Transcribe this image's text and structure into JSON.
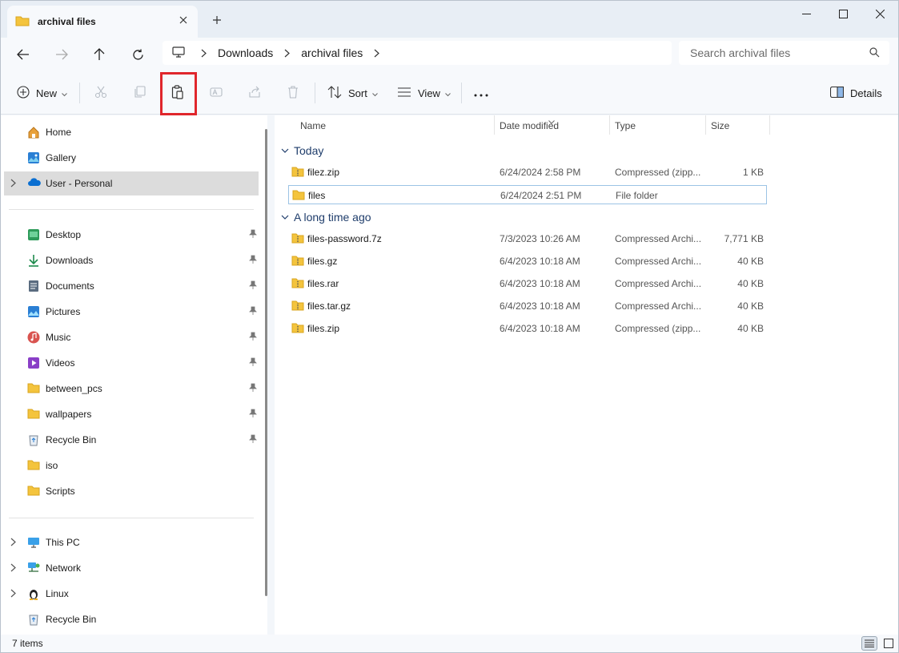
{
  "window": {
    "tab_title": "archival files",
    "colors": {
      "accent": "#0067c0",
      "highlight": "#e0262c",
      "folder": "#f4c43d"
    }
  },
  "nav": {
    "breadcrumbs": [
      "Downloads",
      "archival files"
    ],
    "search_placeholder": "Search archival files"
  },
  "toolbar": {
    "new_label": "New",
    "sort_label": "Sort",
    "view_label": "View",
    "details_label": "Details"
  },
  "sidebar": {
    "top": [
      {
        "label": "Home",
        "icon": "home-icon"
      },
      {
        "label": "Gallery",
        "icon": "gallery-icon"
      },
      {
        "label": "User - Personal",
        "icon": "onedrive-icon"
      }
    ],
    "pinned": [
      {
        "label": "Desktop",
        "icon": "desktop-icon"
      },
      {
        "label": "Downloads",
        "icon": "downloads-icon"
      },
      {
        "label": "Documents",
        "icon": "documents-icon"
      },
      {
        "label": "Pictures",
        "icon": "pictures-icon"
      },
      {
        "label": "Music",
        "icon": "music-icon"
      },
      {
        "label": "Videos",
        "icon": "videos-icon"
      },
      {
        "label": "between_pcs",
        "icon": "folder-icon"
      },
      {
        "label": "wallpapers",
        "icon": "folder-icon"
      },
      {
        "label": "Recycle Bin",
        "icon": "recycle-bin-icon"
      },
      {
        "label": "iso",
        "icon": "folder-icon"
      },
      {
        "label": "Scripts",
        "icon": "folder-icon"
      }
    ],
    "bottom": [
      {
        "label": "This PC",
        "icon": "this-pc-icon"
      },
      {
        "label": "Network",
        "icon": "network-icon"
      },
      {
        "label": "Linux",
        "icon": "linux-icon"
      },
      {
        "label": "Recycle Bin",
        "icon": "recycle-bin-icon"
      }
    ]
  },
  "columns": {
    "name": "Name",
    "date": "Date modified",
    "type": "Type",
    "size": "Size"
  },
  "groups": [
    {
      "label": "Today",
      "files": [
        {
          "name": "filez.zip",
          "date": "6/24/2024 2:58 PM",
          "type": "Compressed (zipp...",
          "size": "1 KB",
          "icon": "zip-icon"
        },
        {
          "name": "files",
          "date": "6/24/2024 2:51 PM",
          "type": "File folder",
          "size": "",
          "icon": "folder-icon"
        }
      ]
    },
    {
      "label": "A long time ago",
      "files": [
        {
          "name": "files-password.7z",
          "date": "7/3/2023 10:26 AM",
          "type": "Compressed Archi...",
          "size": "7,771 KB",
          "icon": "archive-icon"
        },
        {
          "name": "files.gz",
          "date": "6/4/2023 10:18 AM",
          "type": "Compressed Archi...",
          "size": "40 KB",
          "icon": "archive-icon"
        },
        {
          "name": "files.rar",
          "date": "6/4/2023 10:18 AM",
          "type": "Compressed Archi...",
          "size": "40 KB",
          "icon": "archive-icon"
        },
        {
          "name": "files.tar.gz",
          "date": "6/4/2023 10:18 AM",
          "type": "Compressed Archi...",
          "size": "40 KB",
          "icon": "archive-icon"
        },
        {
          "name": "files.zip",
          "date": "6/4/2023 10:18 AM",
          "type": "Compressed (zipp...",
          "size": "40 KB",
          "icon": "zip-icon"
        }
      ]
    }
  ],
  "status": {
    "item_count": "7 items"
  }
}
